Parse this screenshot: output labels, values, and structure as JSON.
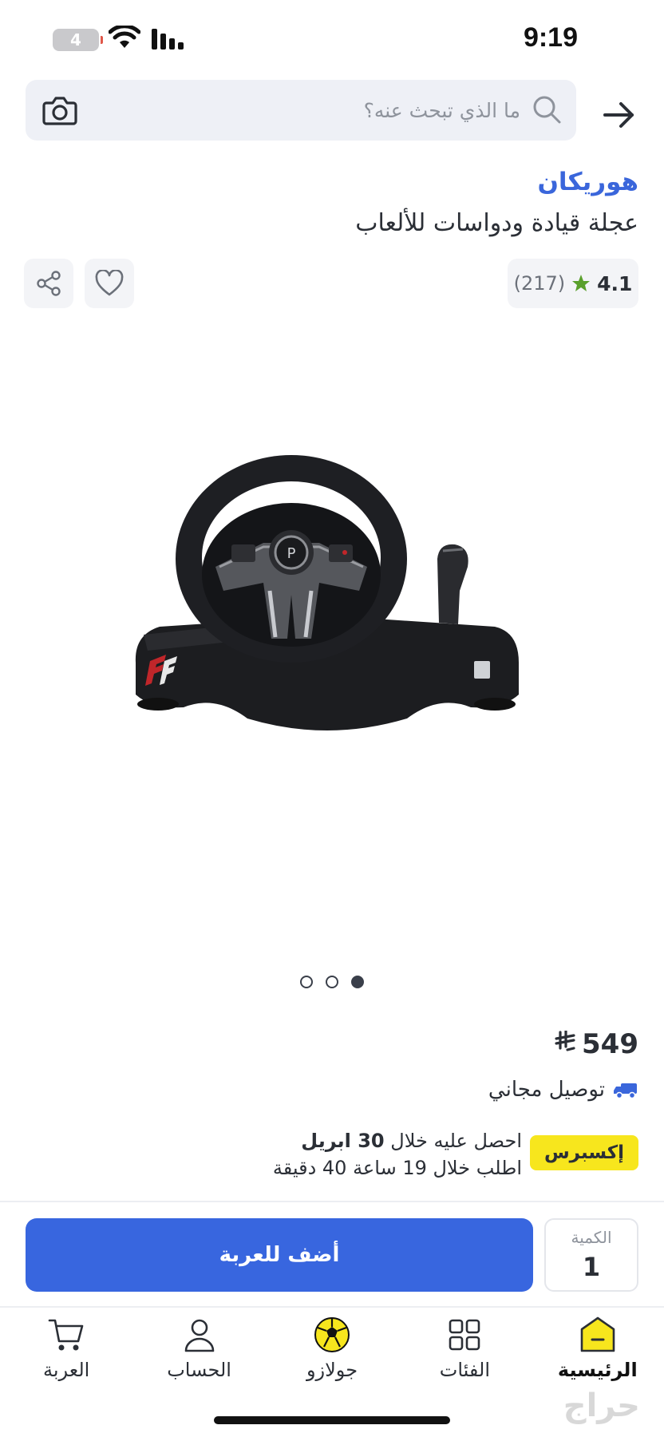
{
  "status_bar": {
    "time": "9:19",
    "battery_level": "4"
  },
  "search": {
    "placeholder": "ما الذي تبحث عنه؟"
  },
  "product": {
    "brand": "هوريكان",
    "title": "عجلة قيادة ودواسات للألعاب",
    "rating": "4.1",
    "rating_count": "(217)",
    "price": "549",
    "currency_symbol": "⃁",
    "shipping": "توصيل مجاني",
    "express_badge": "إكسبرس",
    "delivery_prefix": "احصل عليه خلال",
    "delivery_date": "30 ابريل",
    "order_within": "اطلب خلال 19 ساعة 40 دقيقة"
  },
  "gallery": {
    "image_count": 3,
    "active_index": 0
  },
  "purchase": {
    "quantity_label": "الكمية",
    "quantity_value": "1",
    "add_to_cart": "أضف للعربة"
  },
  "tabbar": {
    "items": [
      {
        "label": "الرئيسية",
        "icon": "home-icon",
        "active": true
      },
      {
        "label": "الفئات",
        "icon": "categories-icon",
        "active": false
      },
      {
        "label": "جولازو",
        "icon": "soccer-ball-icon",
        "active": false
      },
      {
        "label": "الحساب",
        "icon": "account-icon",
        "active": false
      },
      {
        "label": "العربة",
        "icon": "cart-icon",
        "active": false
      }
    ]
  },
  "colors": {
    "accent": "#3866df",
    "brand_link": "#3a66db",
    "express": "#f7e61d",
    "star": "#5aa02c"
  },
  "watermark": "حراج"
}
